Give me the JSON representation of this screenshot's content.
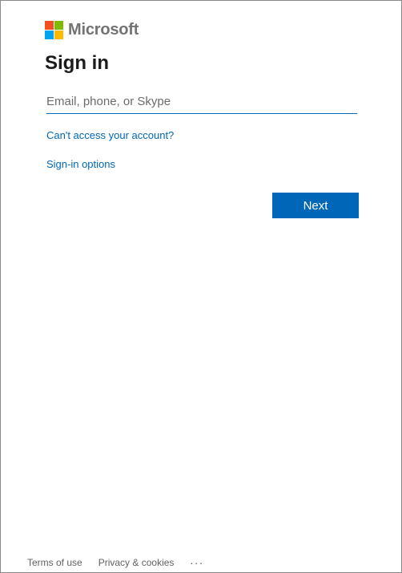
{
  "brand": {
    "name": "Microsoft",
    "logo_colors": [
      "#f25022",
      "#7fba00",
      "#00a4ef",
      "#ffb900"
    ]
  },
  "signin": {
    "title": "Sign in",
    "input_value": "",
    "input_placeholder": "Email, phone, or Skype",
    "cant_access_link": "Can't access your account?",
    "signin_options_link": "Sign-in options",
    "next_button": "Next"
  },
  "footer": {
    "terms": "Terms of use",
    "privacy": "Privacy & cookies",
    "more": "..."
  },
  "colors": {
    "accent": "#0067b8",
    "text": "#1b1b1b",
    "footer_text": "#616161"
  }
}
